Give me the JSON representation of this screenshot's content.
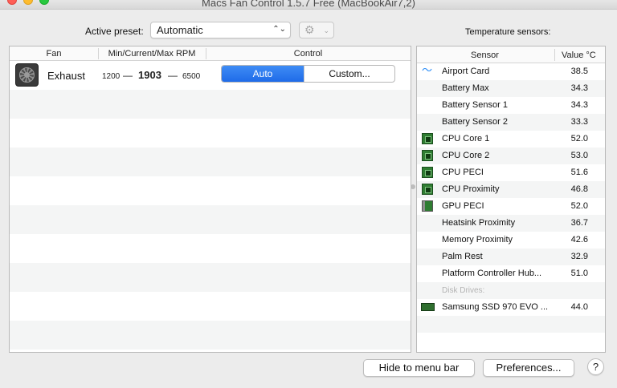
{
  "window": {
    "title": "Macs Fan Control 1.5.7 Free (MacBookAir7,2)"
  },
  "preset": {
    "label": "Active preset:",
    "value": "Automatic",
    "gear_icon": "gear-icon"
  },
  "sensors_title": "Temperature sensors:",
  "fan_table": {
    "headers": {
      "fan": "Fan",
      "rpm": "Min/Current/Max RPM",
      "control": "Control"
    },
    "rows": [
      {
        "name": "Exhaust",
        "min": "1200",
        "dash": "—",
        "current": "1903",
        "max": "6500",
        "control_auto": "Auto",
        "control_custom": "Custom...",
        "selected": "Auto"
      }
    ]
  },
  "sensor_table": {
    "headers": {
      "sensor": "Sensor",
      "value": "Value °C"
    },
    "rows": [
      {
        "name": "Airport Card",
        "value": "38.5",
        "icon": "wifi-icon"
      },
      {
        "name": "Battery Max",
        "value": "34.3",
        "icon": ""
      },
      {
        "name": "Battery Sensor 1",
        "value": "34.3",
        "icon": ""
      },
      {
        "name": "Battery Sensor 2",
        "value": "33.3",
        "icon": ""
      },
      {
        "name": "CPU Core 1",
        "value": "52.0",
        "icon": "cpu-chip-icon"
      },
      {
        "name": "CPU Core 2",
        "value": "53.0",
        "icon": "cpu-chip-icon"
      },
      {
        "name": "CPU PECI",
        "value": "51.6",
        "icon": "cpu-chip-icon"
      },
      {
        "name": "CPU Proximity",
        "value": "46.8",
        "icon": "cpu-chip-icon"
      },
      {
        "name": "GPU PECI",
        "value": "52.0",
        "icon": "gpu-card-icon"
      },
      {
        "name": "Heatsink Proximity",
        "value": "36.7",
        "icon": ""
      },
      {
        "name": "Memory Proximity",
        "value": "42.6",
        "icon": ""
      },
      {
        "name": "Palm Rest",
        "value": "32.9",
        "icon": ""
      },
      {
        "name": "Platform Controller Hub...",
        "value": "51.0",
        "icon": ""
      },
      {
        "name": "Disk Drives:",
        "value": "",
        "icon": "",
        "group": true
      },
      {
        "name": "Samsung SSD 970 EVO ...",
        "value": "44.0",
        "icon": "ssd-icon"
      }
    ]
  },
  "buttons": {
    "hide": "Hide to menu bar",
    "prefs": "Preferences...",
    "help": "?"
  },
  "colors": {
    "accent": "#1f6be8",
    "chip": "#2f7d32",
    "wifi": "#2a8cf7"
  }
}
